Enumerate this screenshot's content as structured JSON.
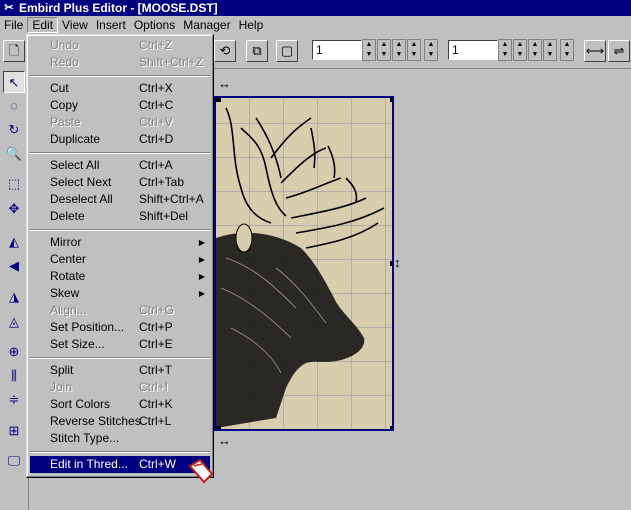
{
  "window": {
    "title": "Embird Plus Editor - [MOOSE.DST]"
  },
  "menubar": [
    "File",
    "Edit",
    "View",
    "Insert",
    "Options",
    "Manager",
    "Help"
  ],
  "toolbar": {
    "value1": "1",
    "value2": "1"
  },
  "edit_menu": {
    "undo": {
      "label": "Undo",
      "shortcut": "Ctrl+Z"
    },
    "redo": {
      "label": "Redo",
      "shortcut": "Shift+Ctrl+Z"
    },
    "cut": {
      "label": "Cut",
      "shortcut": "Ctrl+X"
    },
    "copy": {
      "label": "Copy",
      "shortcut": "Ctrl+C"
    },
    "paste": {
      "label": "Paste",
      "shortcut": "Ctrl+V"
    },
    "duplicate": {
      "label": "Duplicate",
      "shortcut": "Ctrl+D"
    },
    "select_all": {
      "label": "Select All",
      "shortcut": "Ctrl+A"
    },
    "select_next": {
      "label": "Select Next",
      "shortcut": "Ctrl+Tab"
    },
    "deselect_all": {
      "label": "Deselect All",
      "shortcut": "Shift+Ctrl+A"
    },
    "delete": {
      "label": "Delete",
      "shortcut": "Shift+Del"
    },
    "mirror": {
      "label": "Mirror"
    },
    "center": {
      "label": "Center"
    },
    "rotate": {
      "label": "Rotate"
    },
    "skew": {
      "label": "Skew"
    },
    "align": {
      "label": "Align...",
      "shortcut": "Ctrl+G"
    },
    "set_position": {
      "label": "Set Position...",
      "shortcut": "Ctrl+P"
    },
    "set_size": {
      "label": "Set Size...",
      "shortcut": "Ctrl+E"
    },
    "split": {
      "label": "Split",
      "shortcut": "Ctrl+T"
    },
    "join": {
      "label": "Join",
      "shortcut": "Ctrl+I"
    },
    "sort_colors": {
      "label": "Sort Colors",
      "shortcut": "Ctrl+K"
    },
    "reverse_stitches": {
      "label": "Reverse Stitches",
      "shortcut": "Ctrl+L"
    },
    "stitch_type": {
      "label": "Stitch Type..."
    },
    "edit_in_thred": {
      "label": "Edit in Thred...",
      "shortcut": "Ctrl+W"
    }
  },
  "colors": {
    "titlebar": "#000080",
    "highlight": "#000080",
    "hoop_fabric": "#d8ceae"
  },
  "icons": [
    "app-icon",
    "new-file-icon",
    "pointer-icon",
    "lasso-icon",
    "rotate-icon",
    "zoom-icon",
    "move-icon"
  ]
}
